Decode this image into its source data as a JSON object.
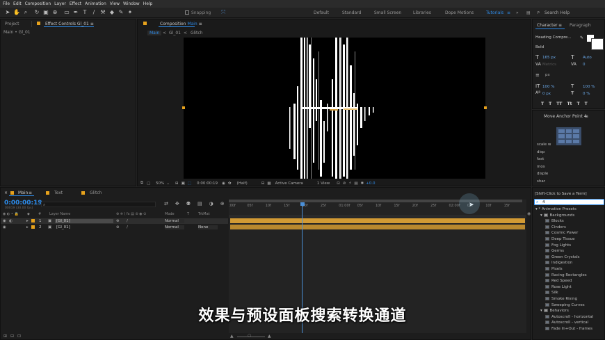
{
  "menu": [
    "File",
    "Edit",
    "Composition",
    "Layer",
    "Effect",
    "Animation",
    "View",
    "Window",
    "Help"
  ],
  "toolbar": {
    "snapping_label": "Snapping",
    "workspaces": [
      "Default",
      "Standard",
      "Small Screen",
      "Libraries",
      "Dope Motions",
      "Tutorials"
    ],
    "active_workspace": "Tutorials",
    "search_help_placeholder": "Search Help"
  },
  "project_panel": {
    "tab_project": "Project",
    "tab_effect_controls": "Effect Controls",
    "effect_controls_target": "Gl_01",
    "breadcrumb": "Main • Gl_01"
  },
  "composition_panel": {
    "tab_label": "Composition",
    "tab_name": "Main",
    "nav_items": [
      "Main",
      "Gl_01",
      "Glitch"
    ],
    "zoom": "50%",
    "timecode": "0:00:00:19",
    "resolution": "(Half)",
    "camera": "Active Camera",
    "views": "1 View",
    "exposure": "+0.0"
  },
  "timeline": {
    "tabs": [
      "Main",
      "Text",
      "Glitch"
    ],
    "current_time": "0:00:00:19",
    "frame_info": "00019 (30.00 fps)",
    "search_placeholder": "",
    "column_headers": [
      "#",
      "Layer Name",
      "Mode",
      "T",
      "TrkMat"
    ],
    "layers": [
      {
        "num": "1",
        "name": "[Gl_01]",
        "mode": "Normal",
        "trkmat": ""
      },
      {
        "num": "2",
        "name": "[Gl_01]",
        "mode": "Normal",
        "trkmat": "None"
      }
    ],
    "ruler_labels": [
      ":00f",
      "05f",
      "10f",
      "15f",
      "20f",
      "25f",
      "01:00f",
      "05f",
      "10f",
      "15f",
      "20f",
      "25f",
      "02:00f",
      "05f",
      "10f",
      "15f"
    ],
    "playhead_fraction": 0.25
  },
  "character_panel": {
    "tab_character": "Character",
    "tab_paragraph": "Paragraph",
    "font_family": "Heading Compre...",
    "font_style": "Bold",
    "font_size": "165 px",
    "leading": "Auto",
    "tracking_metrics": "Metrics",
    "tracking_value": "0",
    "stroke_unit": "px",
    "vert_scale": "100 %",
    "horiz_scale": "100 %",
    "baseline": "0 px",
    "tsume": "0 %",
    "format_buttons": [
      "T",
      "T",
      "TT",
      "Tt",
      "T",
      "T"
    ]
  },
  "script_panel": {
    "title": "Move Anchor Point 4",
    "items": [
      "scale w",
      "disp",
      "fast",
      "mos",
      "disple",
      "shar"
    ]
  },
  "effects_presets": {
    "tooltip": "[Shift-Click to Save a Term]",
    "search_value": "4",
    "tree": [
      {
        "type": "folder",
        "label": "* Animation Presets",
        "level": 0
      },
      {
        "type": "folder",
        "label": "Backgrounds",
        "level": 1
      },
      {
        "type": "item",
        "label": "Blocks",
        "level": 2
      },
      {
        "type": "item",
        "label": "Cinders",
        "level": 2
      },
      {
        "type": "item",
        "label": "Cosmic Power",
        "level": 2
      },
      {
        "type": "item",
        "label": "Deep Tissue",
        "level": 2
      },
      {
        "type": "item",
        "label": "Fog Lights",
        "level": 2
      },
      {
        "type": "item",
        "label": "Germs",
        "level": 2
      },
      {
        "type": "item",
        "label": "Green Crystals",
        "level": 2
      },
      {
        "type": "item",
        "label": "Indigestion",
        "level": 2
      },
      {
        "type": "item",
        "label": "Pixels",
        "level": 2
      },
      {
        "type": "item",
        "label": "Racing Rectangles",
        "level": 2
      },
      {
        "type": "item",
        "label": "Red Speed",
        "level": 2
      },
      {
        "type": "item",
        "label": "Rose Light",
        "level": 2
      },
      {
        "type": "item",
        "label": "Silk",
        "level": 2
      },
      {
        "type": "item",
        "label": "Smoke Rising",
        "level": 2
      },
      {
        "type": "item",
        "label": "Sweeping Curves",
        "level": 2
      },
      {
        "type": "folder",
        "label": "Behaviors",
        "level": 1
      },
      {
        "type": "item",
        "label": "Autoscroll - horizontal",
        "level": 2
      },
      {
        "type": "item",
        "label": "Autoscroll - vertical",
        "level": 2
      },
      {
        "type": "item",
        "label": "Fade In+Out - frames",
        "level": 2
      }
    ]
  },
  "subtitle": "效果与预设面板搜索转换通道",
  "colors": {
    "accent_blue": "#2d8ceb",
    "label_orange": "#e7a21c",
    "layer_bar": "#c99533"
  }
}
